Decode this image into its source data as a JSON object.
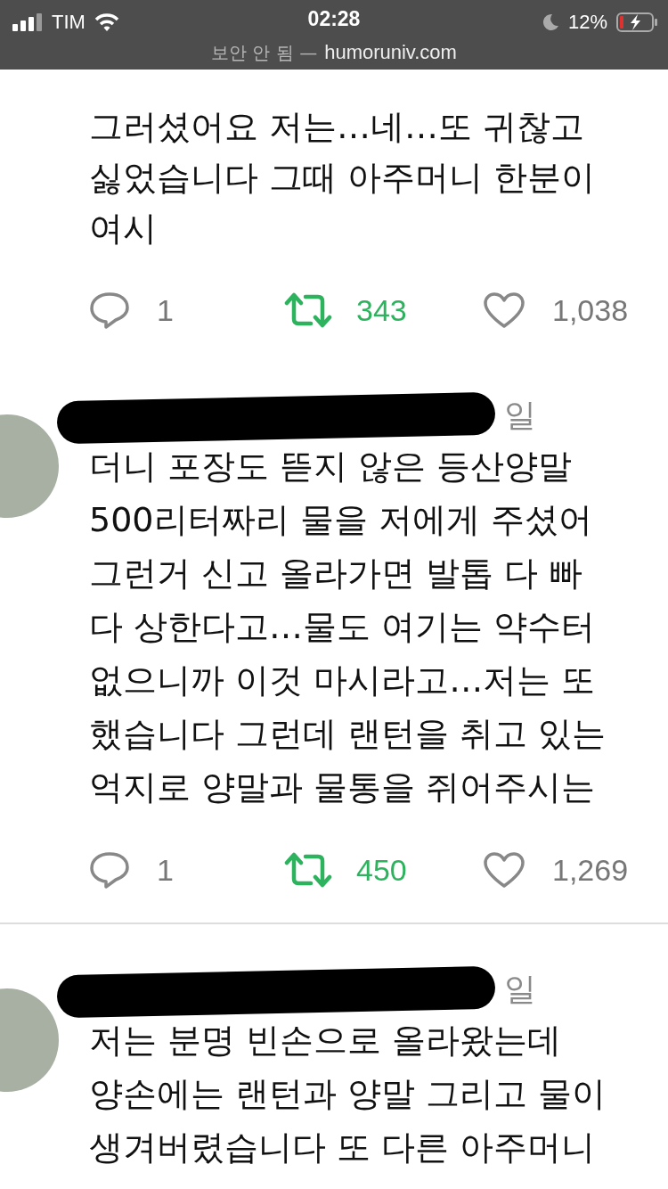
{
  "status_bar": {
    "carrier": "TIM",
    "time": "02:28",
    "battery": "12%"
  },
  "address_bar": {
    "security": "보안 안 됨 —",
    "domain": "humoruniv.com"
  },
  "tweets": [
    {
      "divider_above": false,
      "lines": [
        "그러셨어요 저는…네…또 귀찮고",
        "싫었습니다 그때 아주머니 한분이",
        "여시"
      ],
      "actions": {
        "replies": "1",
        "retweets": "343",
        "likes": "1,038"
      }
    },
    {
      "divider_above": false,
      "header": {
        "date": "일"
      },
      "lines": [
        "더니 포장도 뜯지 않은 등산양말",
        "500리터짜리 물을 저에게 주셨어",
        "그런거 신고 올라가면 발톱 다 빠",
        "다 상한다고…물도 여기는 약수터",
        "없으니까 이것 마시라고…저는 또",
        "했습니다 그런데 랜턴을 취고 있는",
        "억지로 양말과 물통을 쥐어주시는"
      ],
      "actions": {
        "replies": "1",
        "retweets": "450",
        "likes": "1,269"
      }
    },
    {
      "divider_above": true,
      "header": {
        "date": "일"
      },
      "lines": [
        "저는 분명 빈손으로 올라왔는데",
        "양손에는 랜턴과 양말 그리고 물이",
        "생겨버렸습니다 또 다른 아주머니"
      ]
    }
  ]
}
